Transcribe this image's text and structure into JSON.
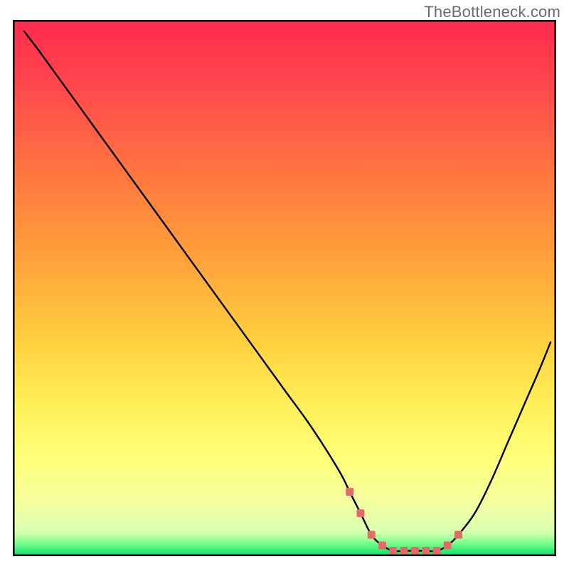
{
  "watermark": "TheBottleneck.com",
  "chart_data": {
    "type": "line",
    "title": "",
    "xlabel": "",
    "ylabel": "",
    "xlim": [
      0,
      100
    ],
    "ylim": [
      0,
      100
    ],
    "x": [
      2,
      5,
      10,
      15,
      20,
      25,
      30,
      35,
      40,
      45,
      50,
      55,
      60,
      62,
      64,
      66,
      68,
      70,
      72,
      74,
      76,
      78,
      80,
      82,
      85,
      88,
      91,
      94,
      97,
      99
    ],
    "values": [
      98,
      94,
      87,
      80,
      73,
      66,
      59,
      52,
      45,
      38,
      31,
      24,
      16,
      12,
      8,
      4,
      2,
      1,
      1,
      1,
      1,
      1,
      2,
      4,
      8,
      14,
      21,
      28,
      35,
      40
    ],
    "marker_region": {
      "x": [
        62,
        64,
        66,
        68,
        70,
        72,
        74,
        76,
        78,
        80,
        82
      ],
      "values": [
        12,
        8,
        4,
        2,
        1,
        1,
        1,
        1,
        1,
        2,
        4
      ]
    },
    "gradient_stops": [
      {
        "offset": 0.0,
        "color": "#ff2a4f"
      },
      {
        "offset": 0.15,
        "color": "#ff4f4a"
      },
      {
        "offset": 0.3,
        "color": "#ff7a3e"
      },
      {
        "offset": 0.45,
        "color": "#ffa23a"
      },
      {
        "offset": 0.6,
        "color": "#ffd03e"
      },
      {
        "offset": 0.72,
        "color": "#fff05a"
      },
      {
        "offset": 0.82,
        "color": "#ffff7a"
      },
      {
        "offset": 0.9,
        "color": "#f4ffa0"
      },
      {
        "offset": 0.955,
        "color": "#d8ffb0"
      },
      {
        "offset": 0.975,
        "color": "#7cff8c"
      },
      {
        "offset": 1.0,
        "color": "#00e06a"
      }
    ],
    "curve_color": "#000000",
    "marker_color": "#e46a6a",
    "border_color": "#000000"
  }
}
